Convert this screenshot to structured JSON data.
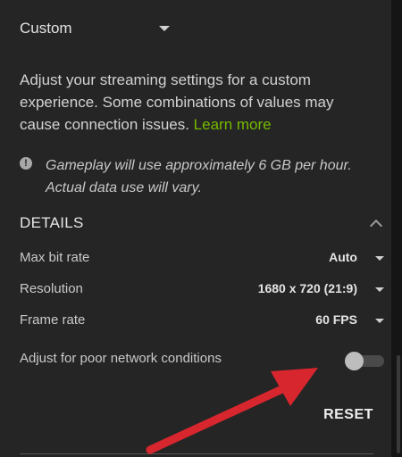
{
  "preset": {
    "label": "Custom"
  },
  "description": {
    "text": "Adjust your streaming settings for a custom experience. Some combinations of values may cause connection issues. ",
    "link_label": "Learn more"
  },
  "info": {
    "icon": "exclamation-circle-icon",
    "line1": "Gameplay will use approximately 6 GB per hour.",
    "line2": "Actual data use will vary."
  },
  "details": {
    "title": "DETAILS",
    "settings": [
      {
        "label": "Max bit rate",
        "value": "Auto"
      },
      {
        "label": "Resolution",
        "value": "1680 x 720 (21:9)"
      },
      {
        "label": "Frame rate",
        "value": "60 FPS"
      }
    ],
    "network_toggle": {
      "label": "Adjust for poor network conditions",
      "state": "off"
    }
  },
  "actions": {
    "reset_label": "RESET"
  },
  "colors": {
    "background": "#252525",
    "link": "#76b900",
    "annotation_arrow": "#d7262e"
  }
}
